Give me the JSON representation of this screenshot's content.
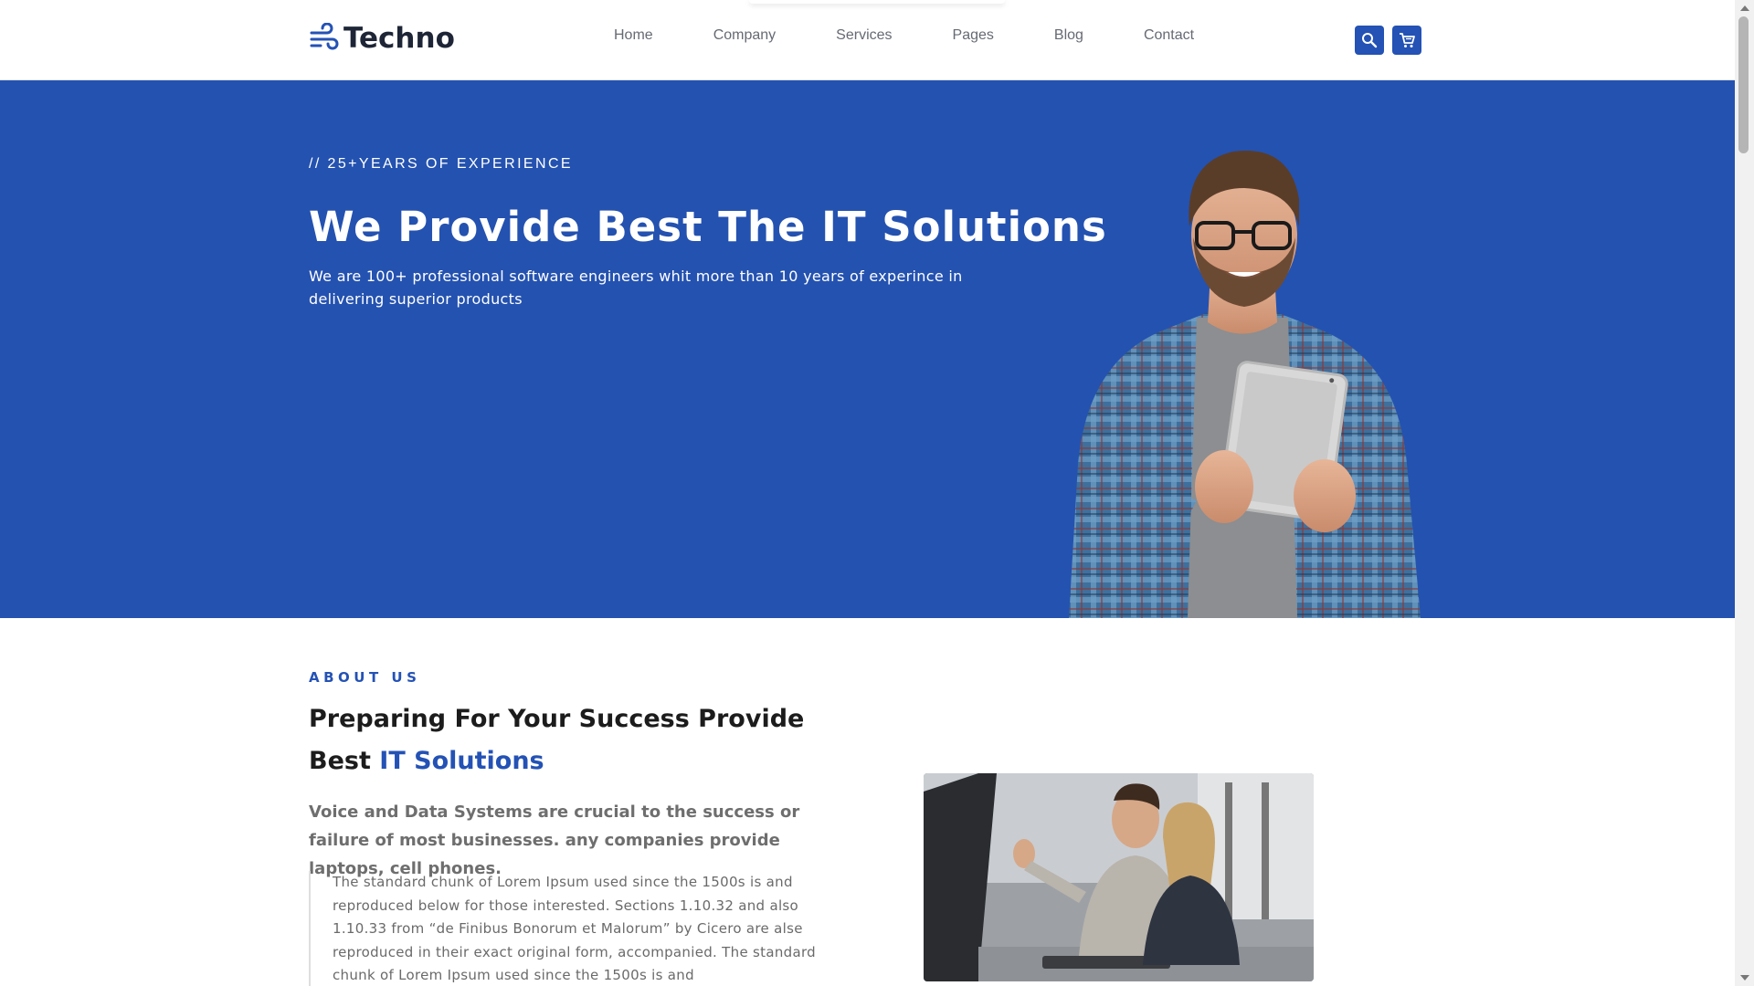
{
  "brand": {
    "name": "Techno",
    "accent_color": "#2452b5",
    "icon": "wind-logo-icon"
  },
  "nav": {
    "items": [
      {
        "label": "Home"
      },
      {
        "label": "Company"
      },
      {
        "label": "Services"
      },
      {
        "label": "Pages"
      },
      {
        "label": "Blog"
      },
      {
        "label": "Contact"
      }
    ]
  },
  "header_actions": {
    "search_icon": "search-icon",
    "cart_icon": "cart-icon"
  },
  "hero": {
    "eyebrow": "// 25+YEARS OF EXPERIENCE",
    "title": "We Provide Best The IT Solutions",
    "subtitle": "We are 100+ professional software engineers whit more than 10 years of experince in delivering superior products",
    "background_color": "#2452b0"
  },
  "about": {
    "eyebrow": "ABOUT US",
    "title_plain": "Preparing For Your Success Provide Best ",
    "title_accent": "IT Solutions",
    "lead": "Voice and Data Systems are crucial to the success or failure of most businesses. any companies provide laptops, cell phones.",
    "quote": "The standard chunk of Lorem Ipsum used since the 1500s is and reproduced below for those interested. Sections 1.10.32 and also 1.10.33 from “de Finibus Bonorum et Malorum” by Cicero are alse reproduced in their exact original form, accompanied. The standard chunk of Lorem Ipsum used since the 1500s is and"
  }
}
